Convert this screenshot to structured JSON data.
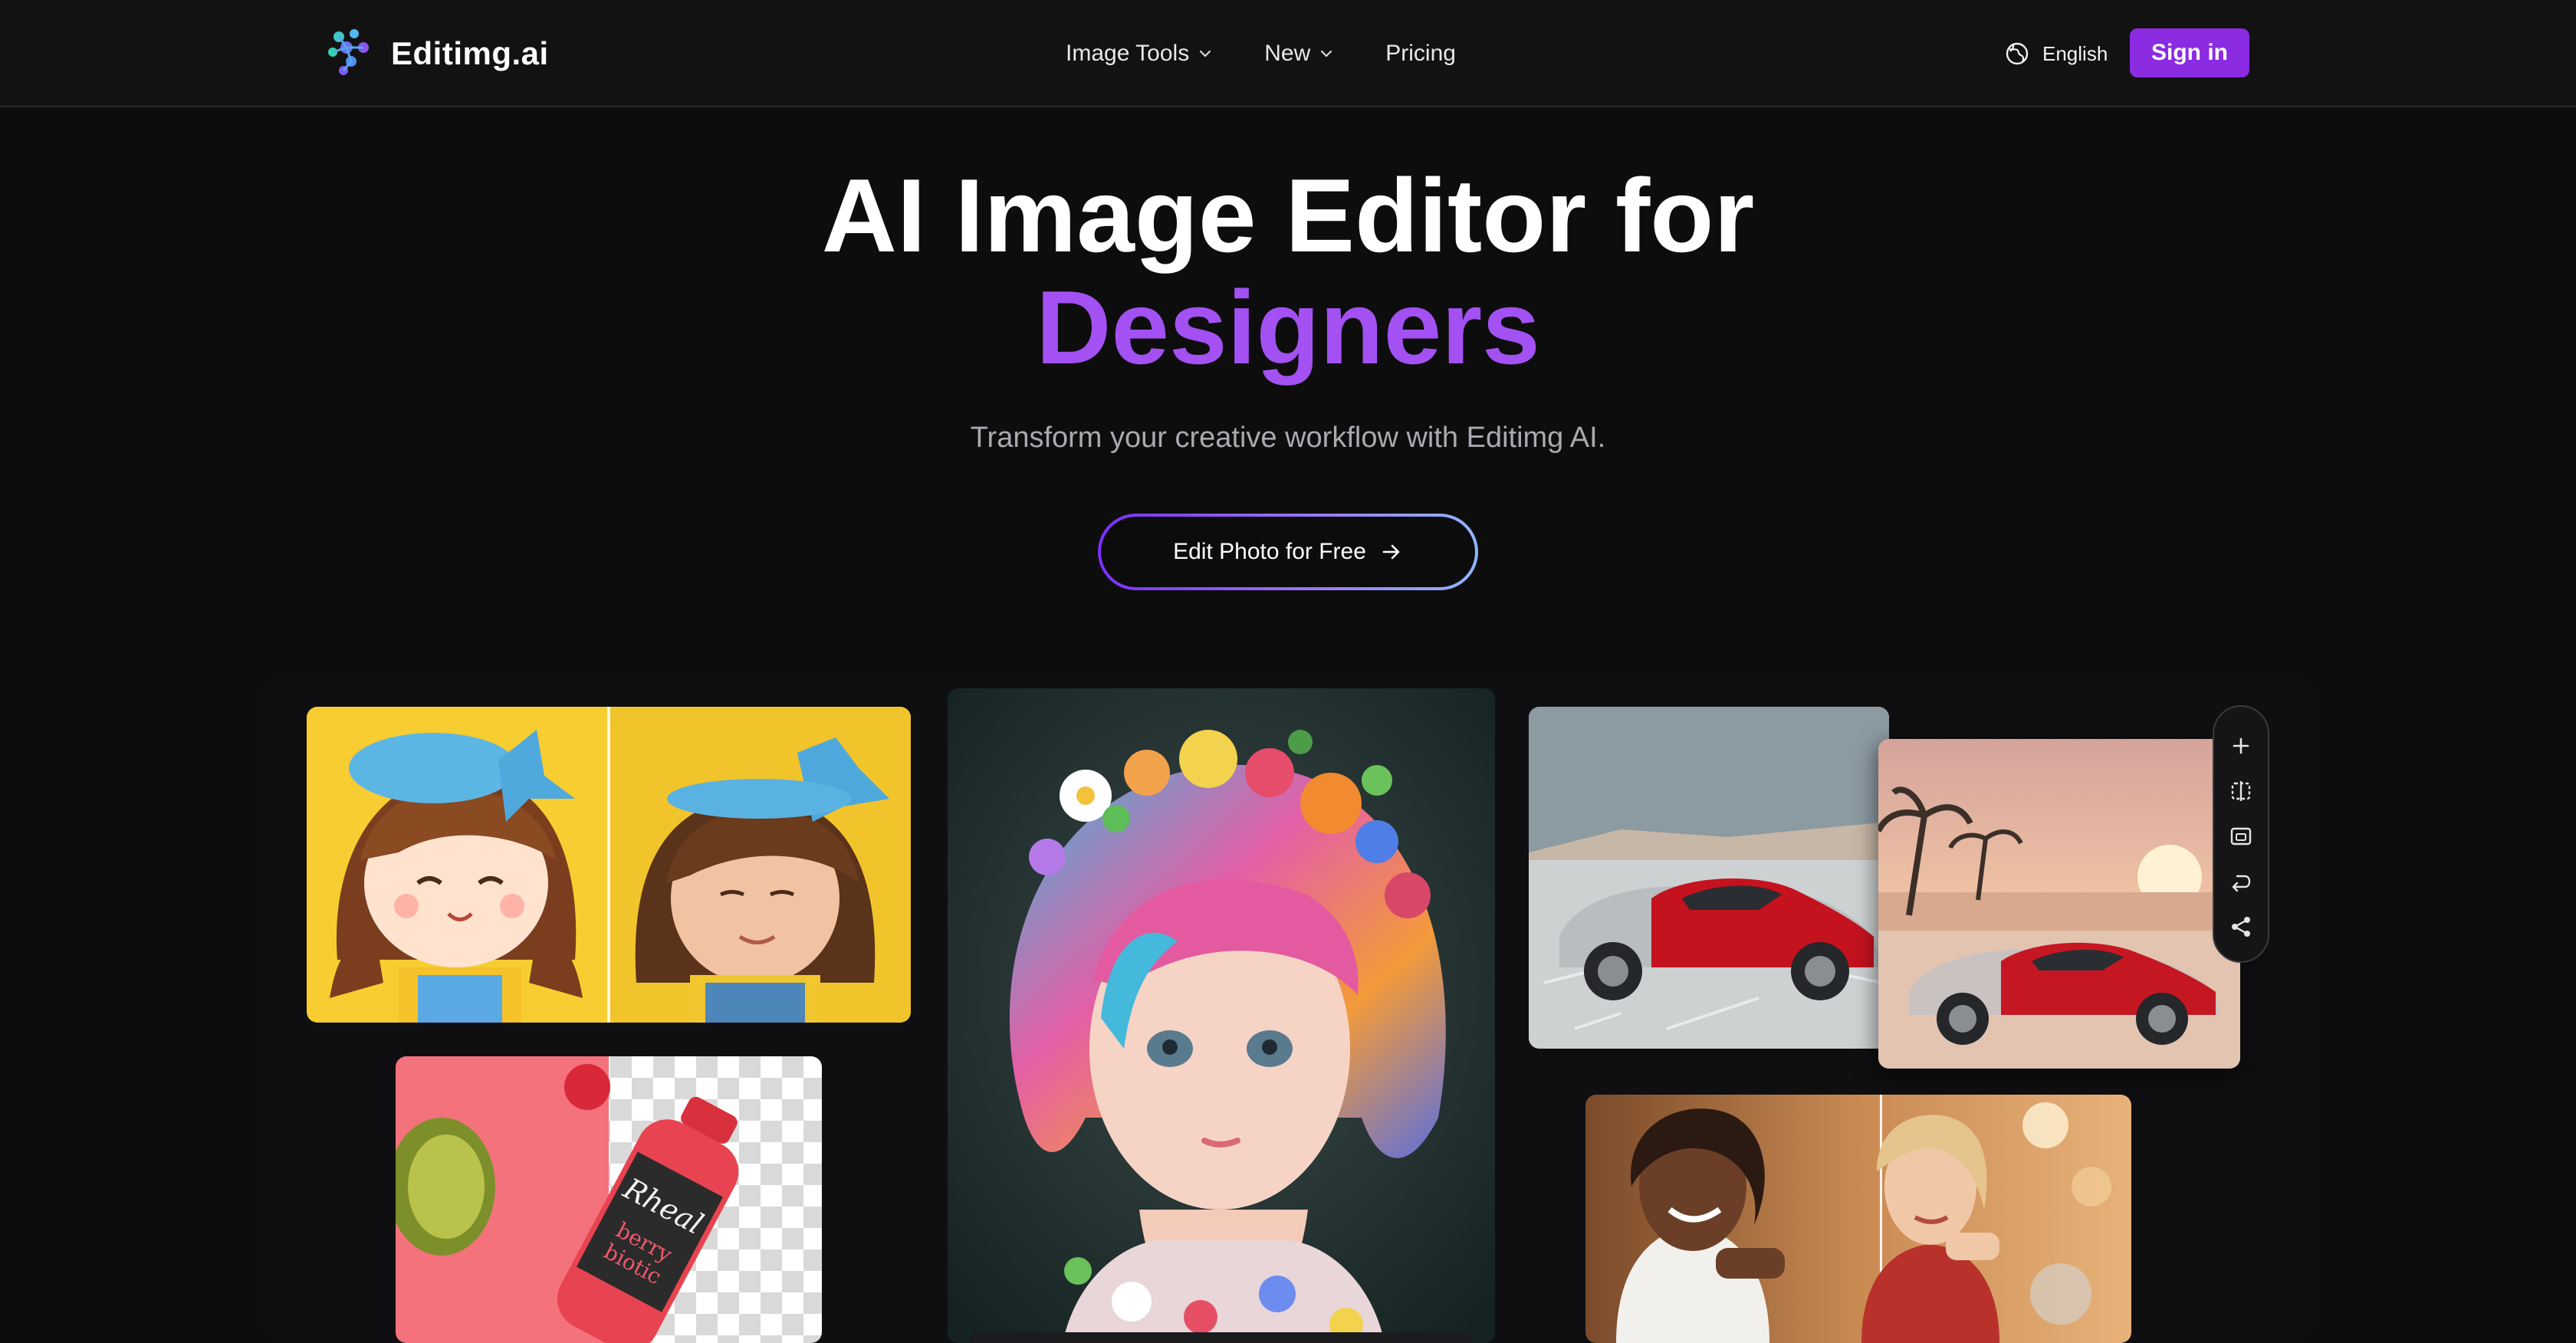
{
  "brand": {
    "name": "Editimg.ai",
    "logo_icon": "dots-logo-icon"
  },
  "nav": {
    "items": [
      {
        "label": "Image Tools",
        "has_dropdown": true
      },
      {
        "label": "New",
        "has_dropdown": true
      },
      {
        "label": "Pricing",
        "has_dropdown": false
      }
    ],
    "language": "English",
    "language_icon": "globe-icon",
    "sign_in": "Sign in"
  },
  "hero": {
    "title_line1": "AI Image Editor for",
    "title_line2": "Designers",
    "subtitle": "Transform your creative workflow with Editimg AI.",
    "cta": "Edit Photo for Free",
    "cta_icon": "arrow-right-icon"
  },
  "gallery": {
    "toolbar_icons": [
      "plus-icon",
      "compare-icon",
      "resize-icon",
      "undo-icon",
      "share-icon"
    ]
  },
  "colors": {
    "accent": "#8b2be2",
    "title_accent": "#a351f2",
    "background": "#0d0d0e",
    "navbar": "#121213"
  }
}
